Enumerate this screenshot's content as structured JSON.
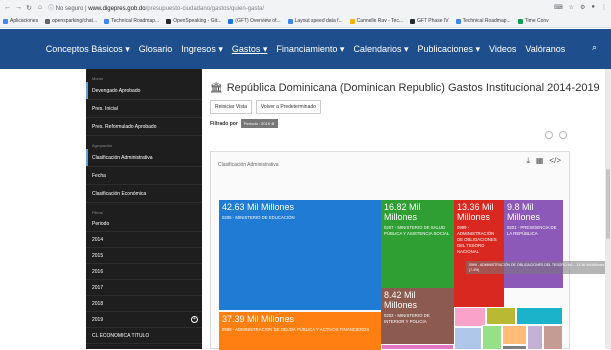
{
  "browser": {
    "url_prefix": "ⓘ No seguro |",
    "url_host": "www.digepres.gob.do",
    "url_path": "/presupuesto-ciudadano/gastos/quien-gasta/",
    "bookmarks": [
      {
        "label": "Aplicaciones",
        "color": "#4285f4"
      },
      {
        "label": "opensparking/chat...",
        "color": "#5f6368"
      },
      {
        "label": "Technical Roadmap...",
        "color": "#4285f4"
      },
      {
        "label": "OpenSpeaking - Git...",
        "color": "#24292e"
      },
      {
        "label": "(GFT) Overview of...",
        "color": "#1a73e8"
      },
      {
        "label": "Layout speed data f...",
        "color": "#4285f4"
      },
      {
        "label": "Cannelle Rav - Tec...",
        "color": "#f4b400"
      },
      {
        "label": "GFT Phase IV",
        "color": "#24292e"
      },
      {
        "label": "Technical Roadmap...",
        "color": "#4285f4"
      },
      {
        "label": "Time Conv",
        "color": "#0f9d58"
      }
    ]
  },
  "site_nav": [
    {
      "label": "Conceptos Básicos ▾"
    },
    {
      "label": "Glosario"
    },
    {
      "label": "Ingresos ▾"
    },
    {
      "label": "Gastos ▾",
      "active": true
    },
    {
      "label": "Financiamiento ▾"
    },
    {
      "label": "Calendarios ▾"
    },
    {
      "label": "Publicaciones ▾"
    },
    {
      "label": "Videos"
    },
    {
      "label": "Valóranos"
    }
  ],
  "sidebar": {
    "sections": [
      {
        "header": "Monto",
        "items": [
          "Devengado Aprobado",
          "Pres. Inicial",
          "Pres. Reformulado Aprobado"
        ]
      },
      {
        "header": "Agrupación",
        "items": [
          "Clasificación Administrativa",
          "Fecha",
          "Clasificación Económica"
        ]
      },
      {
        "header": "Filtros",
        "items": [
          "Periodo",
          "2014",
          "2015",
          "2016",
          "2017",
          "2018",
          "2019",
          "CL ECONOMICA TITULO"
        ]
      }
    ]
  },
  "main": {
    "title": "República Dominicana (Dominican Republic) Gastos Institucional 2014-2019",
    "buttons": [
      "Reiniciar Vista",
      "Volver a Predeterminado"
    ],
    "filter_label": "Filtrado por",
    "filter_chip": "Período : 2019 ⊗",
    "panel_title": "Clasificación Administrativa"
  },
  "treemap": [
    {
      "value": "42.63 Mil Millones",
      "label": "0206 - MINISTERIO DE EDUCACIÓN",
      "color": "#1f7bd4"
    },
    {
      "value": "16.82 Mil Millones",
      "label": "0207 - MINISTERIO DE SALUD PÚBLICA Y ASISTENCIA SOCIAL",
      "color": "#2f9e33"
    },
    {
      "value": "13.36 Mil Millones",
      "label": "0999 - ADMINISTRACIÓN DE OBLIGACIONES DEL TESORO NACIONAL",
      "color": "#d9281f"
    },
    {
      "value": "9.8 Mil Millones",
      "label": "0201 - PRESIDENCIA DE LA REPÚBLICA",
      "color": "#8c59b8"
    },
    {
      "value": "37.39 Mil Millones",
      "label": "0998 - ADMINISTRACIÓN DE DEUDA PÚBLICA Y ACTIVOS FINANCIEROS",
      "color": "#ff7f11"
    },
    {
      "value": "8.42 Mil Millones",
      "label": "0202 - MINISTERIO DE INTERIOR Y POLICIA",
      "color": "#8c5a4f"
    }
  ],
  "tooltip": "0999 - ADMINISTRACIÓN DE OBLIGACIONES DEL TESORO NA... 13.36 Mil Millones (7.4%)"
}
